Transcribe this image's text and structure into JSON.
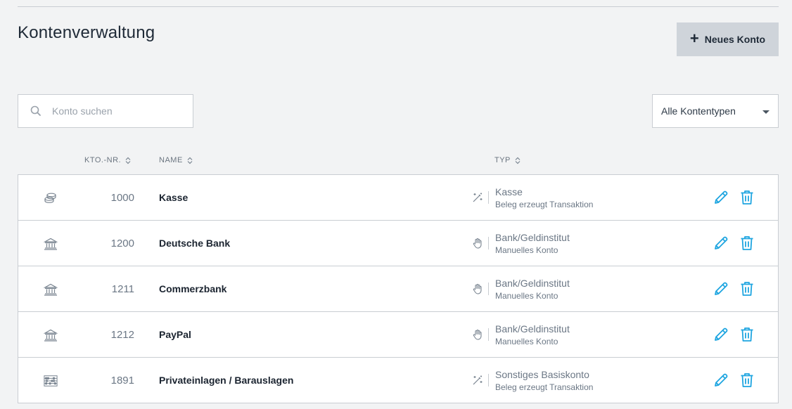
{
  "header": {
    "title": "Kontenverwaltung",
    "new_button_label": "Neues Konto",
    "new_button_icon": "plus-icon"
  },
  "filters": {
    "search_placeholder": "Konto suchen",
    "search_value": "",
    "type_select_value": "Alle Kontentypen"
  },
  "columns": {
    "nr": "KTO.-NR.",
    "name": "NAME",
    "typ": "TYP"
  },
  "colors": {
    "accent": "#1ea5e0",
    "muted": "#6b7785",
    "icon": "#7a8591"
  },
  "rows": [
    {
      "icon": "coins-icon",
      "nr": "1000",
      "name": "Kasse",
      "mode_icon": "magic-wand-icon",
      "typ": "Kasse",
      "typ_sub": "Beleg erzeugt Transaktion"
    },
    {
      "icon": "bank-icon",
      "nr": "1200",
      "name": "Deutsche Bank",
      "mode_icon": "hand-icon",
      "typ": "Bank/Geldinstitut",
      "typ_sub": "Manuelles Konto"
    },
    {
      "icon": "bank-icon",
      "nr": "1211",
      "name": "Commerzbank",
      "mode_icon": "hand-icon",
      "typ": "Bank/Geldinstitut",
      "typ_sub": "Manuelles Konto"
    },
    {
      "icon": "bank-icon",
      "nr": "1212",
      "name": "PayPal",
      "mode_icon": "hand-icon",
      "typ": "Bank/Geldinstitut",
      "typ_sub": "Manuelles Konto"
    },
    {
      "icon": "abacus-icon",
      "nr": "1891",
      "name": "Privateinlagen / Barauslagen",
      "mode_icon": "magic-wand-icon",
      "typ": "Sonstiges Basiskonto",
      "typ_sub": "Beleg erzeugt Transaktion"
    }
  ]
}
